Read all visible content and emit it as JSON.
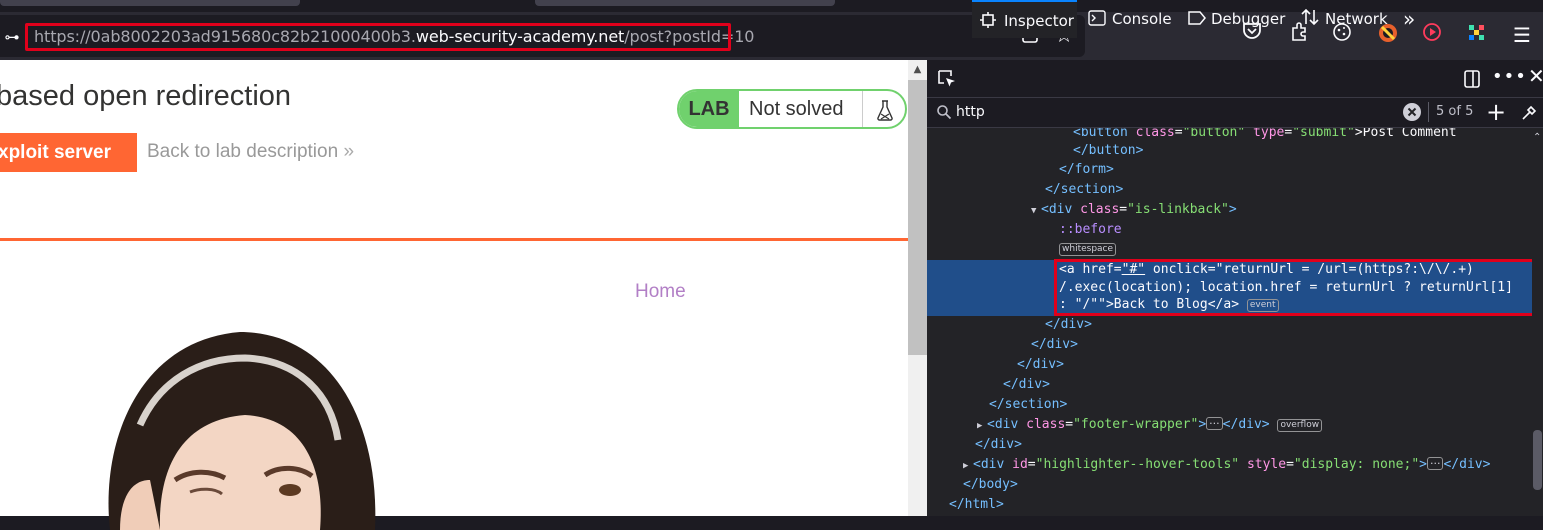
{
  "browser": {
    "url_prefix": "https://0ab8002203ad915680c82b21000400b3.",
    "url_domain": "web-security-academy.net",
    "url_path": "/post?postId=10",
    "reader_icon": "reader-view-icon",
    "bookmark_icon": "star-icon"
  },
  "page": {
    "title": "based open redirection",
    "lab_label": "LAB",
    "lab_status": "Not solved",
    "exploit_button": "xploit server",
    "back_link": "Back to lab description",
    "back_arrow": "»",
    "home_link": "Home"
  },
  "devtools": {
    "tabs": {
      "inspector": "Inspector",
      "console": "Console",
      "debugger": "Debugger",
      "network": "Network"
    },
    "search_value": "http",
    "search_count": "5 of 5",
    "lines": {
      "l1_tag": "<button",
      "l1_attr1": " class",
      "l1_val1": "\"button\"",
      "l1_attr2": " type",
      "l1_val2": "\"submit\"",
      "l1_end": ">Post Comment",
      "l2": "</button>",
      "l3": "</form>",
      "l4": "</section>",
      "l5_tag": "<div",
      "l5_attr": " class",
      "l5_val": "\"is-linkback\"",
      "l5_end": ">",
      "l6": "::before",
      "l7_badge": "whitespace",
      "l8_tag": "<a",
      "l8_attr1": " href",
      "l8_val1": "\"#\"",
      "l8_attr2": " onclick",
      "l8_val2": "\"returnUrl = /url=(https?:\\/\\/.+)",
      "l9_val": "/.exec(location); location.href = returnUrl ? returnUrl[1]",
      "l10_val": ": \"/\"\"",
      "l10_end": ">Back to Blog",
      "l10_close": "</a>",
      "l10_badge": "event",
      "l11": "</div>",
      "l12": "</div>",
      "l13": "</div>",
      "l14": "</div>",
      "l15": "</section>",
      "l16_tag": "<div",
      "l16_attr": " class",
      "l16_val": "\"footer-wrapper\"",
      "l16_end": ">",
      "l16_dots": "···",
      "l16_close": "</div>",
      "l16_badge": "overflow",
      "l17": "</div>",
      "l18_tag": "<div",
      "l18_attr1": " id",
      "l18_val1": "\"highlighter--hover-tools\"",
      "l18_attr2": " style",
      "l18_val2": "\"display: none;\"",
      "l18_end": ">",
      "l18_dots": "···",
      "l18_close": "</div>",
      "l19": "</body>",
      "l20": "</html>"
    }
  },
  "colors": {
    "accent_orange": "#ff6633",
    "lab_green": "#70d16d",
    "selection_blue": "#204e8a",
    "highlight_red": "#e0001b"
  }
}
